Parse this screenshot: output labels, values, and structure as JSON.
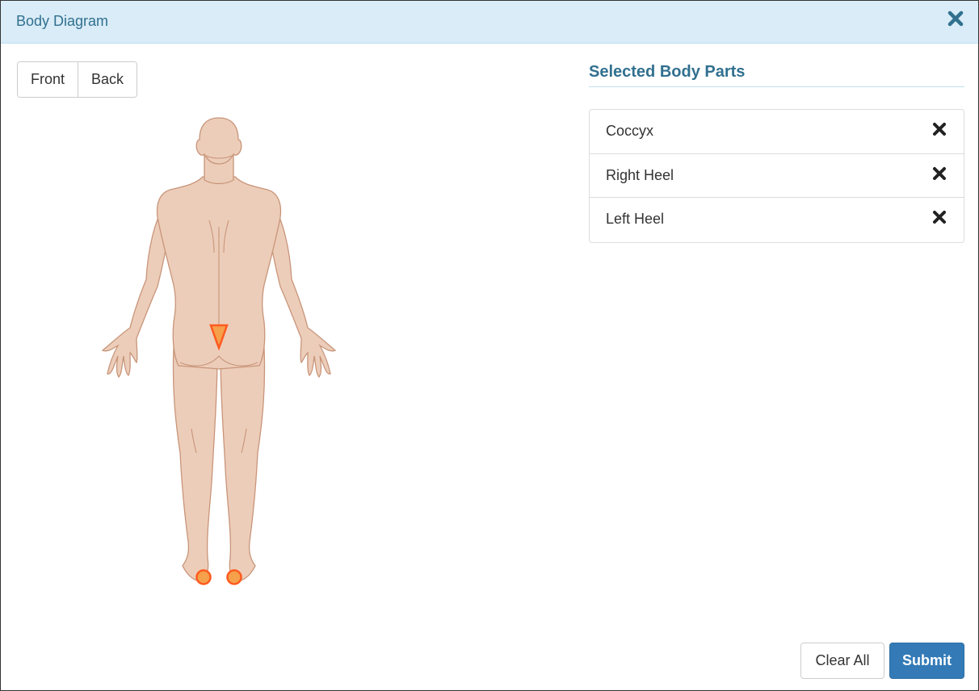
{
  "modal": {
    "title": "Body Diagram",
    "close_icon": "close-icon"
  },
  "view_toggle": {
    "front_label": "Front",
    "back_label": "Back",
    "active_view": "Back"
  },
  "diagram": {
    "view": "back",
    "highlighted_regions": [
      "Coccyx",
      "Right Heel",
      "Left Heel"
    ],
    "highlight_color": "#f5a04a",
    "highlight_stroke": "#ff5a1f",
    "skin_color": "#eccdb9",
    "outline_color": "#c8957a"
  },
  "selected_parts": {
    "heading": "Selected Body Parts",
    "items": [
      {
        "label": "Coccyx",
        "remove_icon": "remove-icon"
      },
      {
        "label": "Right Heel",
        "remove_icon": "remove-icon"
      },
      {
        "label": "Left Heel",
        "remove_icon": "remove-icon"
      }
    ]
  },
  "footer": {
    "clear_label": "Clear All",
    "submit_label": "Submit"
  },
  "colors": {
    "header_bg": "#d9ecf7",
    "title_color": "#31708f",
    "primary": "#337ab7"
  }
}
